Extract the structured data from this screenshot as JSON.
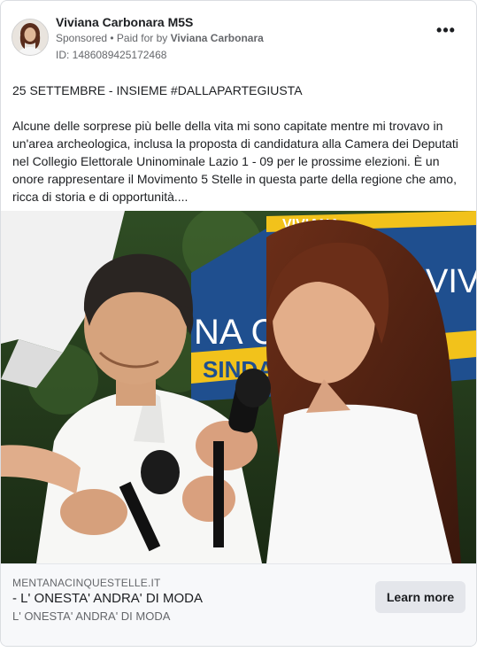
{
  "post": {
    "page_name": "Viviana Carbonara M5S",
    "sponsored_label": "Sponsored",
    "paid_for_prefix": "• Paid for by",
    "paid_for_name": "Viviana Carbonara",
    "ad_id": "ID: 1486089425172468",
    "more_icon": "•••",
    "body_paragraphs": [
      "25 SETTEMBRE - INSIEME #DALLAPARTEGIUSTA",
      "Alcune delle sorprese più belle della vita mi sono capitate mentre mi trovavo in un'area archeologica, inclusa la proposta di candidatura alla Camera dei Deputati nel Collegio Elettorale Uninominale Lazio 1 - 09 per le prossime elezioni. È un onore rappresentare il Movimento 5 Stelle in questa parte della regione che amo, ricca di storia e di opportunità...."
    ]
  },
  "media": {
    "banner_text_1": "VIVIANA",
    "banner_text_2": "NA CA",
    "banner_text_3": "SINDACA",
    "banner_text_4": "VIVIA"
  },
  "link_card": {
    "domain": "MENTANACINQUESTELLE.IT",
    "headline": "- L' ONESTA' ANDRA' DI MODA",
    "description": "L' ONESTA' ANDRA' DI MODA",
    "cta_label": "Learn more"
  },
  "colors": {
    "banner_blue": "#1f4f8f",
    "banner_yellow": "#f2c21b",
    "text_secondary": "#65676b"
  }
}
